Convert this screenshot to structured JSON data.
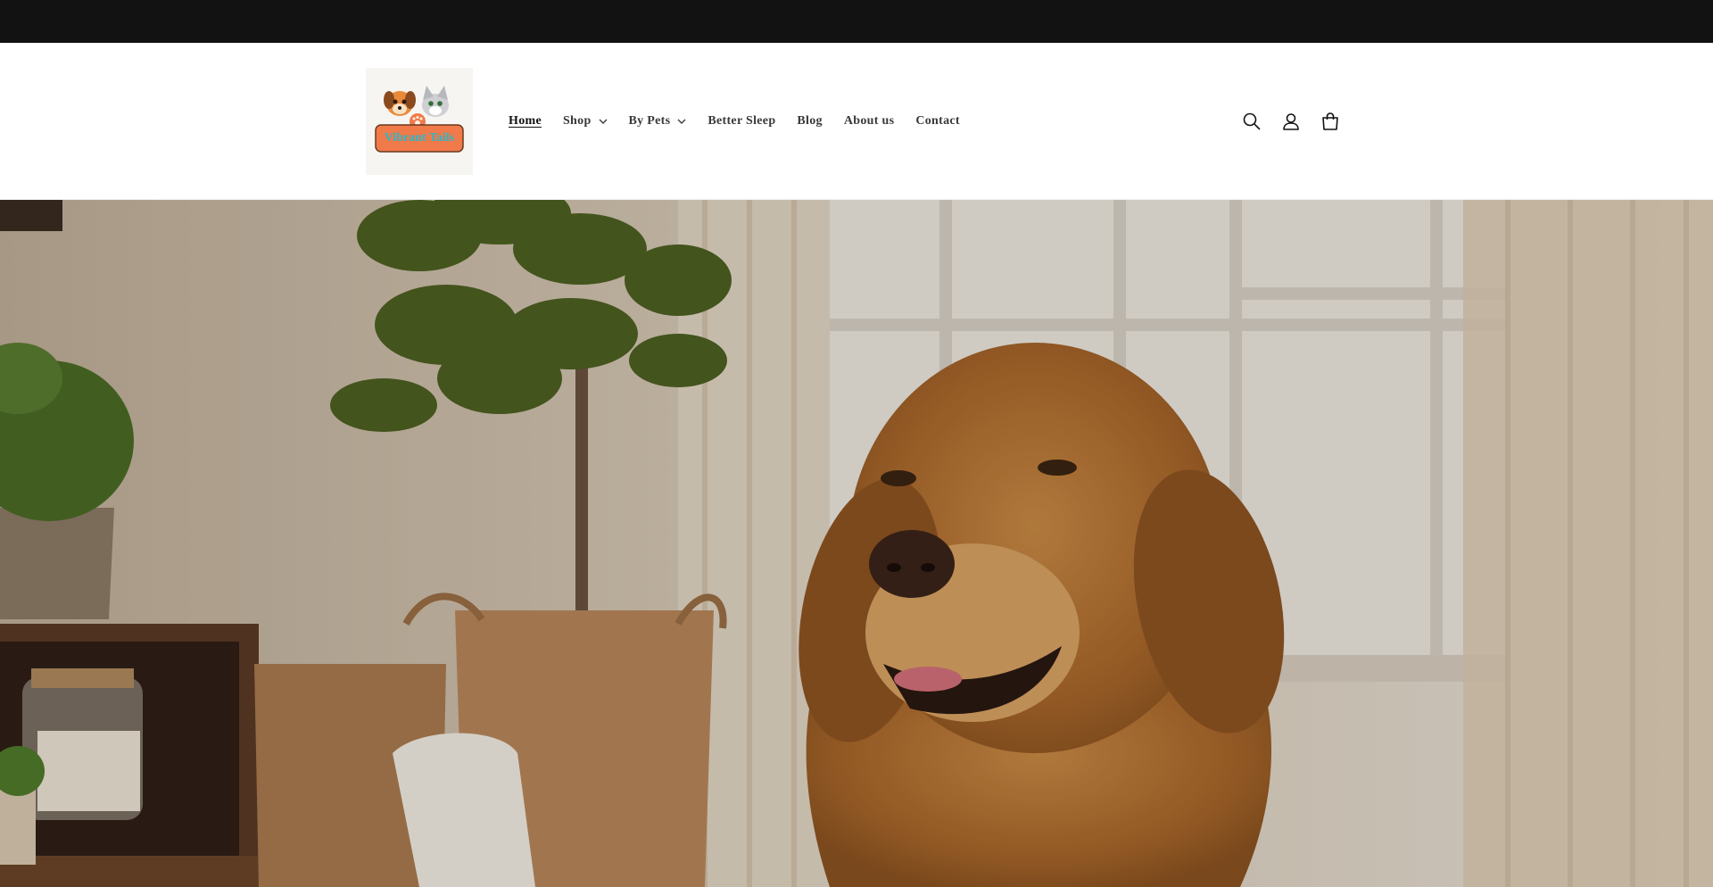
{
  "announcement": {
    "text": ""
  },
  "header": {
    "logo_text": "Vibrant Tails",
    "nav": [
      {
        "label": "Home",
        "active": true,
        "has_dropdown": false
      },
      {
        "label": "Shop",
        "active": false,
        "has_dropdown": true
      },
      {
        "label": "By Pets",
        "active": false,
        "has_dropdown": true
      },
      {
        "label": "Better Sleep",
        "active": false,
        "has_dropdown": false
      },
      {
        "label": "Blog",
        "active": false,
        "has_dropdown": false
      },
      {
        "label": "About us",
        "active": false,
        "has_dropdown": false
      },
      {
        "label": "Contact",
        "active": false,
        "has_dropdown": false
      }
    ],
    "icons": [
      "search-icon",
      "account-icon",
      "cart-icon"
    ]
  },
  "colors": {
    "announcement_bg": "#121212",
    "header_bg": "#ffffff",
    "logo_badge": "#f07a4a",
    "logo_text": "#2bb7c9"
  }
}
